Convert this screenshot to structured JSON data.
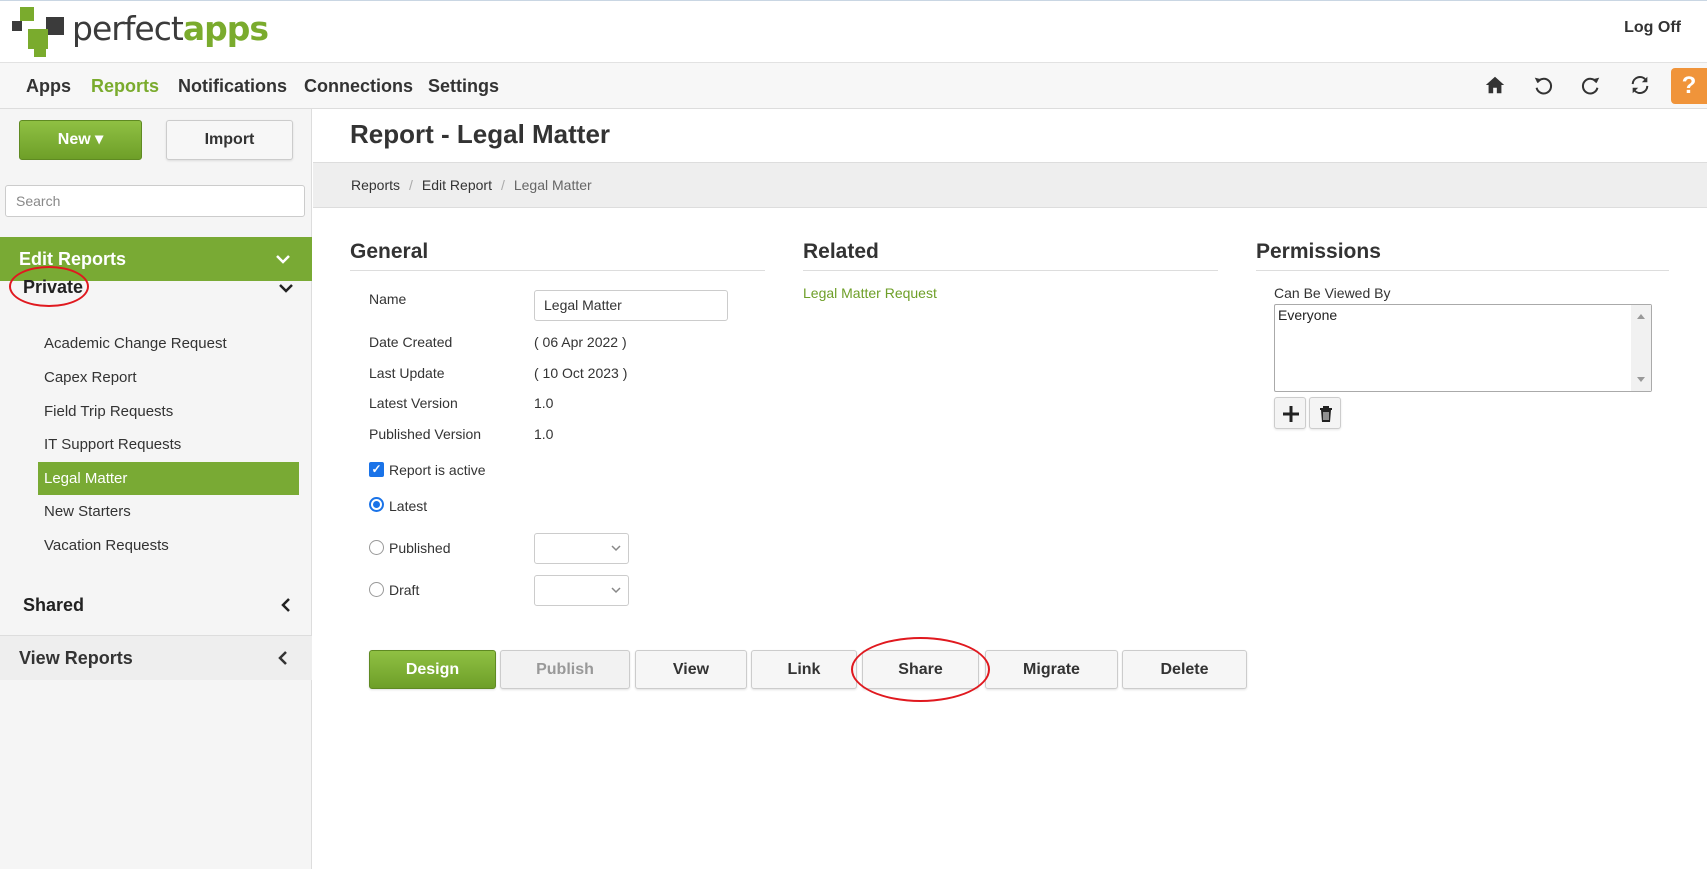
{
  "header": {
    "logo_part1": "perfect",
    "logo_part2": "apps",
    "logoff": "Log Off"
  },
  "nav": {
    "items": [
      "Apps",
      "Reports",
      "Notifications",
      "Connections",
      "Settings"
    ],
    "active": "Reports",
    "help": "?"
  },
  "sidebar": {
    "new_label": "New",
    "import_label": "Import",
    "search_placeholder": "Search",
    "edit_reports": "Edit Reports",
    "private": "Private",
    "private_items": [
      "Academic Change Request",
      "Capex Report",
      "Field Trip Requests",
      "IT Support Requests",
      "Legal Matter",
      "New Starters",
      "Vacation Requests"
    ],
    "selected": "Legal Matter",
    "shared": "Shared",
    "view_reports": "View Reports"
  },
  "main": {
    "title": "Report - Legal Matter",
    "breadcrumb": [
      "Reports",
      "Edit Report",
      "Legal Matter"
    ],
    "general": {
      "heading": "General",
      "name_label": "Name",
      "name_value": "Legal Matter",
      "date_created_label": "Date Created",
      "date_created": "( 06 Apr 2022 )",
      "last_update_label": "Last Update",
      "last_update": "( 10 Oct 2023 )",
      "latest_version_label": "Latest Version",
      "latest_version": "1.0",
      "published_version_label": "Published Version",
      "published_version": "1.0",
      "active_label": "Report is active",
      "latest_label": "Latest",
      "published_label": "Published",
      "draft_label": "Draft"
    },
    "related": {
      "heading": "Related",
      "link": "Legal Matter Request"
    },
    "permissions": {
      "heading": "Permissions",
      "label": "Can Be Viewed By",
      "entries": [
        "Everyone"
      ]
    },
    "actions": [
      "Design",
      "Publish",
      "View",
      "Link",
      "Share",
      "Migrate",
      "Delete"
    ]
  },
  "colors": {
    "brand_green": "#79aa34",
    "help_orange": "#f0943a",
    "highlight_red": "#e0191f"
  }
}
